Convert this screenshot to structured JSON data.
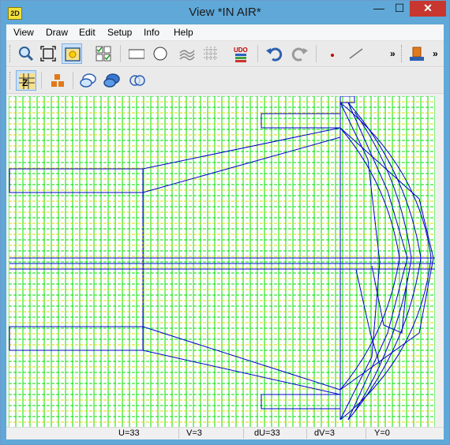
{
  "window": {
    "title": "View   *IN AIR*",
    "icon_label": "2D",
    "min_glyph": "—",
    "max_glyph": "☐",
    "close_glyph": "✕"
  },
  "menu": [
    "View",
    "Draw",
    "Edit",
    "Setup",
    "Info",
    "Help"
  ],
  "toolbar1": {
    "tools": [
      "zoom-icon",
      "fit-icon",
      "view-fill-icon",
      "checklist-icon",
      "rectangle-icon",
      "circle-icon",
      "surface-icon",
      "grid-icon",
      "udo-icon",
      "undo-icon",
      "redo-icon",
      "point-icon",
      "line-icon",
      "export-icon"
    ],
    "udo_label": "UDO",
    "overflow": "»"
  },
  "toolbar2": {
    "tools": [
      "grid-snap-icon",
      "blocks-icon",
      "bubble-outline-icon",
      "bubble-filled-icon",
      "bubble-overlap-icon"
    ]
  },
  "status": {
    "u": "U=33",
    "v": "V=3",
    "du": "dU=33",
    "dv": "dV=3",
    "y": "Y=0"
  },
  "colors": {
    "grid_green": "#00e000",
    "grid_yellow": "#d8d800",
    "geometry_blue": "#0000cc",
    "accent_red": "#c7372f"
  }
}
